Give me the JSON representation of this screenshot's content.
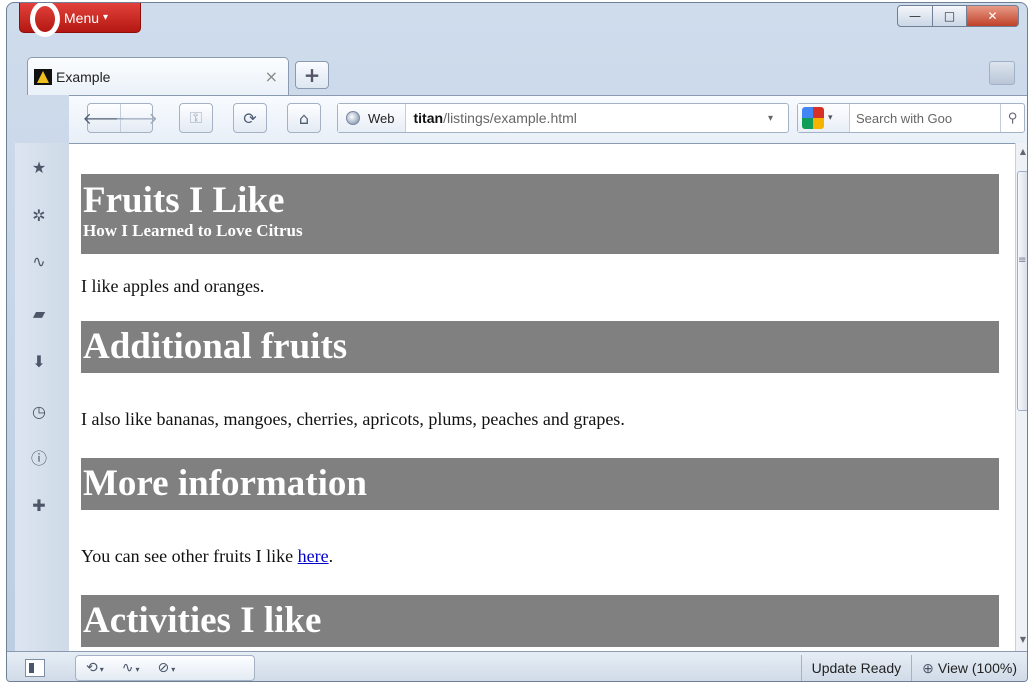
{
  "window": {
    "menu_label": "Menu",
    "controls": {
      "minimize": "—",
      "maximize": "□",
      "close": "✕"
    }
  },
  "tabs": [
    {
      "title": "Example",
      "close": "×",
      "icon": "site-icon"
    }
  ],
  "new_tab_label": "+",
  "toolbar": {
    "back": "🡐",
    "forward": "🡒",
    "wand": "⚿",
    "reload": "⟳",
    "home": "⌂",
    "web_label": "Web",
    "url_host": "titan",
    "url_path": "/listings/example.html",
    "search_placeholder": "Search with Goo",
    "search_engine": "google-icon"
  },
  "sidebar": [
    {
      "icon": "bookmarks-icon",
      "glyph": "★"
    },
    {
      "icon": "widgets-icon",
      "glyph": "✲"
    },
    {
      "icon": "unite-icon",
      "glyph": "∿"
    },
    {
      "icon": "notes-icon",
      "glyph": "▰"
    },
    {
      "icon": "downloads-icon",
      "glyph": "⬇"
    },
    {
      "icon": "history-icon",
      "glyph": "◷"
    },
    {
      "icon": "info-icon",
      "glyph": "ⓘ"
    },
    {
      "icon": "add-panel-icon",
      "glyph": "✚"
    }
  ],
  "page": {
    "h1": "Fruits I Like",
    "h1_sub": "How I Learned to Love Citrus",
    "p1": "I like apples and oranges.",
    "h2_1": "Additional fruits",
    "p2": "I also like bananas, mangoes, cherries, apricots, plums, peaches and grapes.",
    "h2_2": "More information",
    "p3_prefix": "You can see other fruits I like ",
    "p3_link": "here",
    "p3_suffix": ".",
    "h2_3": "Activities I like"
  },
  "statusbar": {
    "tools": [
      "⟲",
      "∿",
      "⊘"
    ],
    "update": "Update Ready",
    "zoom": "View (100%)"
  },
  "colors": {
    "heading_bg": "#808080",
    "link": "#0000cc",
    "menu_red": "#c8241e"
  }
}
